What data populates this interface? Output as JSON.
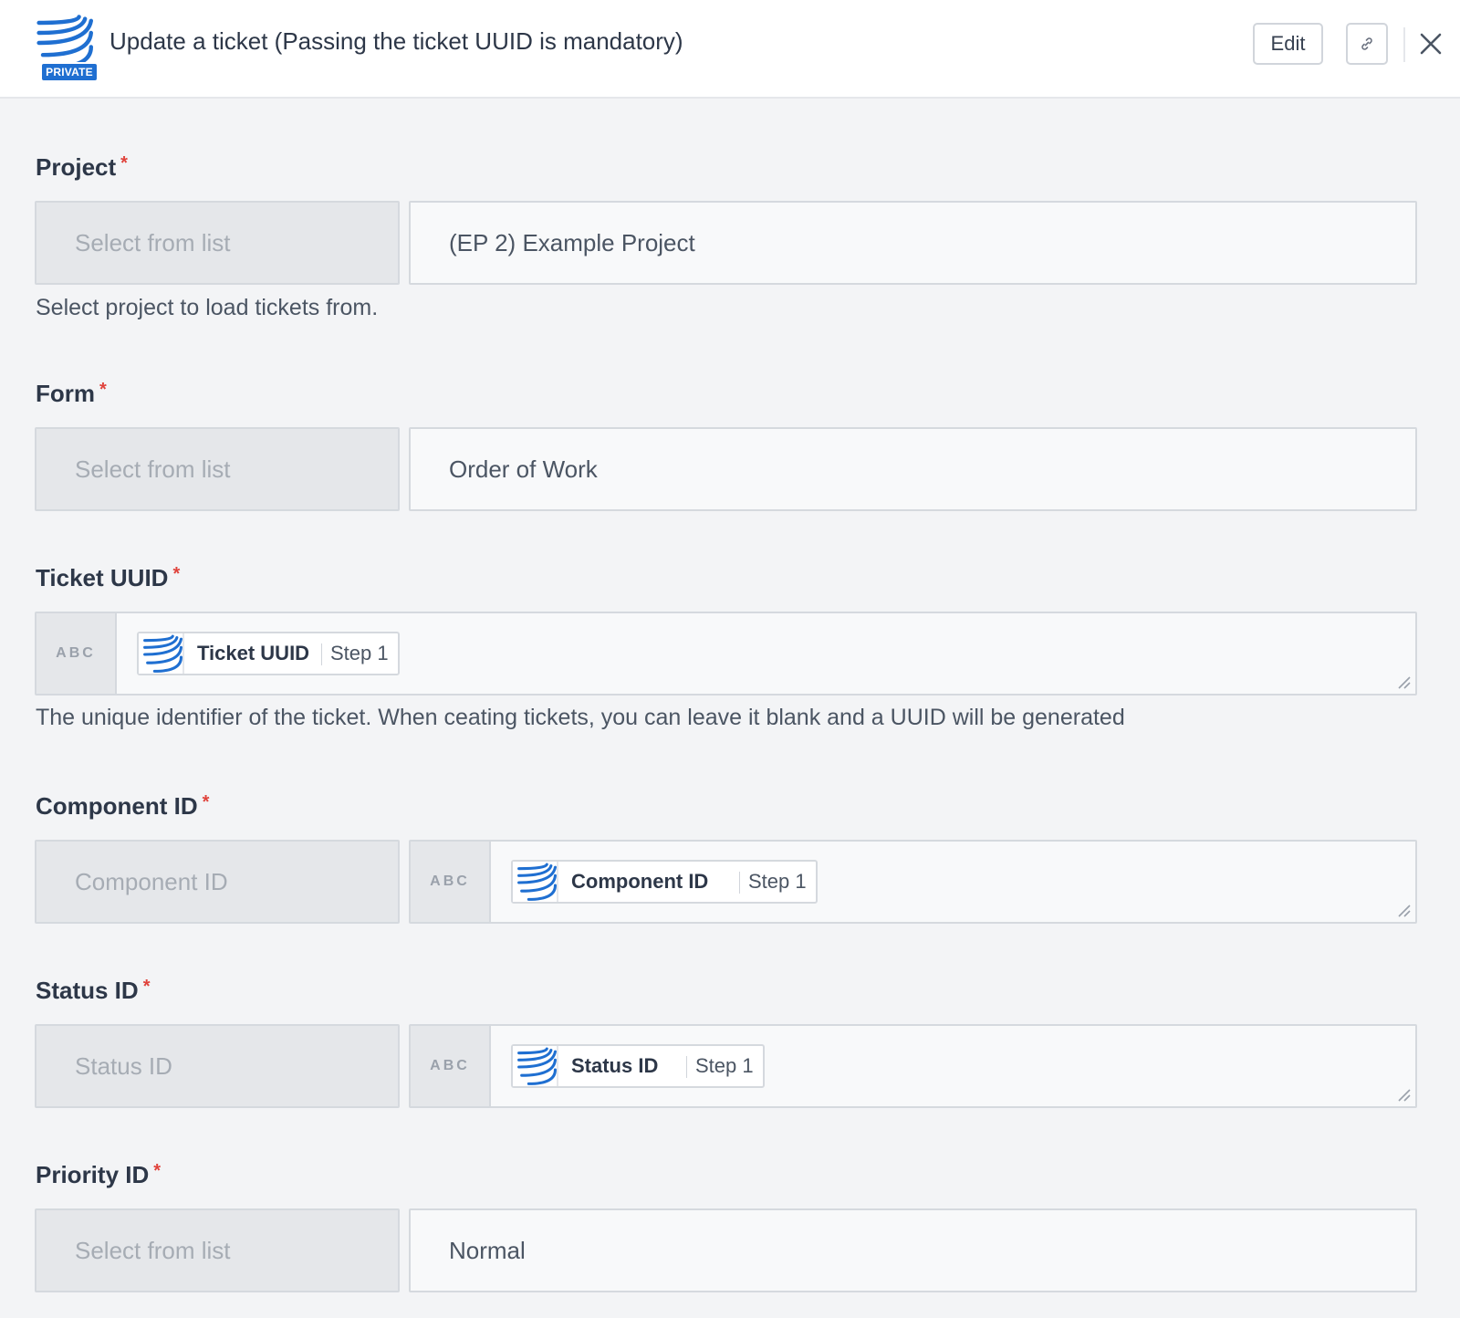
{
  "header": {
    "title": "Update a ticket (Passing the ticket UUID is mandatory)",
    "badge": "PRIVATE",
    "logo_icon": "app-logo-icon",
    "edit_label": "Edit",
    "link_icon": "link-icon",
    "close_icon": "close-icon"
  },
  "required_marker": "*",
  "fields": {
    "project": {
      "label": "Project",
      "mode_placeholder": "Select from list",
      "value": "(EP 2) Example Project",
      "help": "Select project to load tickets from."
    },
    "form": {
      "label": "Form",
      "mode_placeholder": "Select from list",
      "value": "Order of Work"
    },
    "ticket_uuid": {
      "label": "Ticket UUID",
      "type_tag": "ABC",
      "pill_name": "Ticket UUID",
      "pill_step": "Step 1",
      "help": "The unique identifier of the ticket. When ceating tickets, you can leave it blank and a UUID will be generated"
    },
    "component_id": {
      "label": "Component ID",
      "mode_placeholder": "Component ID",
      "type_tag": "ABC",
      "pill_name": "Component ID",
      "pill_step": "Step 1"
    },
    "status_id": {
      "label": "Status ID",
      "mode_placeholder": "Status ID",
      "type_tag": "ABC",
      "pill_name": "Status ID",
      "pill_step": "Step 1"
    },
    "priority_id": {
      "label": "Priority ID",
      "mode_placeholder": "Select from list",
      "value": "Normal"
    }
  },
  "colors": {
    "brand_blue": "#1f6fd1",
    "required_red": "#e0433c",
    "background": "#f3f4f6"
  }
}
